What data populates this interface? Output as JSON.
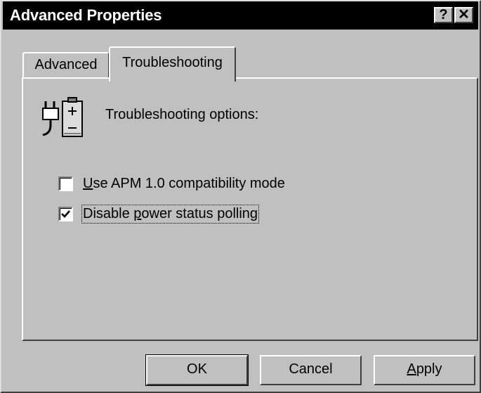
{
  "window": {
    "title": "Advanced Properties",
    "help_button": "?",
    "close_button": "✕"
  },
  "tabs": [
    {
      "label": "Advanced",
      "active": false
    },
    {
      "label": "Troubleshooting",
      "active": true
    }
  ],
  "panel": {
    "header_text": "Troubleshooting options:",
    "icon": "power-plug-battery-icon",
    "options": [
      {
        "label_accel": "U",
        "label_rest": "se APM 1.0 compatibility mode",
        "checked": false
      },
      {
        "label_pre": "Disable ",
        "label_accel": "p",
        "label_rest": "ower status polling",
        "checked": true
      }
    ]
  },
  "buttons": {
    "ok": "OK",
    "cancel": "Cancel",
    "apply_accel": "A",
    "apply_rest": "pply"
  }
}
